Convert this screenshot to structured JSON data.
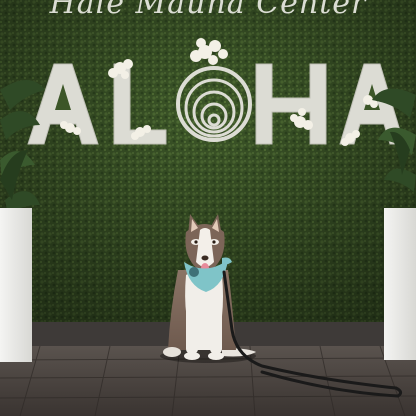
{
  "sign": {
    "top_text": "Hale Mauna Center",
    "main_letters": [
      "A",
      "L",
      "O",
      "H",
      "A"
    ]
  },
  "colors": {
    "hedge": "#3f5a2a",
    "hedge_dark": "#2c4220",
    "letters": "#dcdcd4",
    "planter": "#ececea",
    "floor": "#4a4440",
    "bandana": "#7fc4c8",
    "leash": "#1a1a1a"
  },
  "icons": [
    "orchid-flower",
    "palm-plant",
    "dog-leash"
  ]
}
